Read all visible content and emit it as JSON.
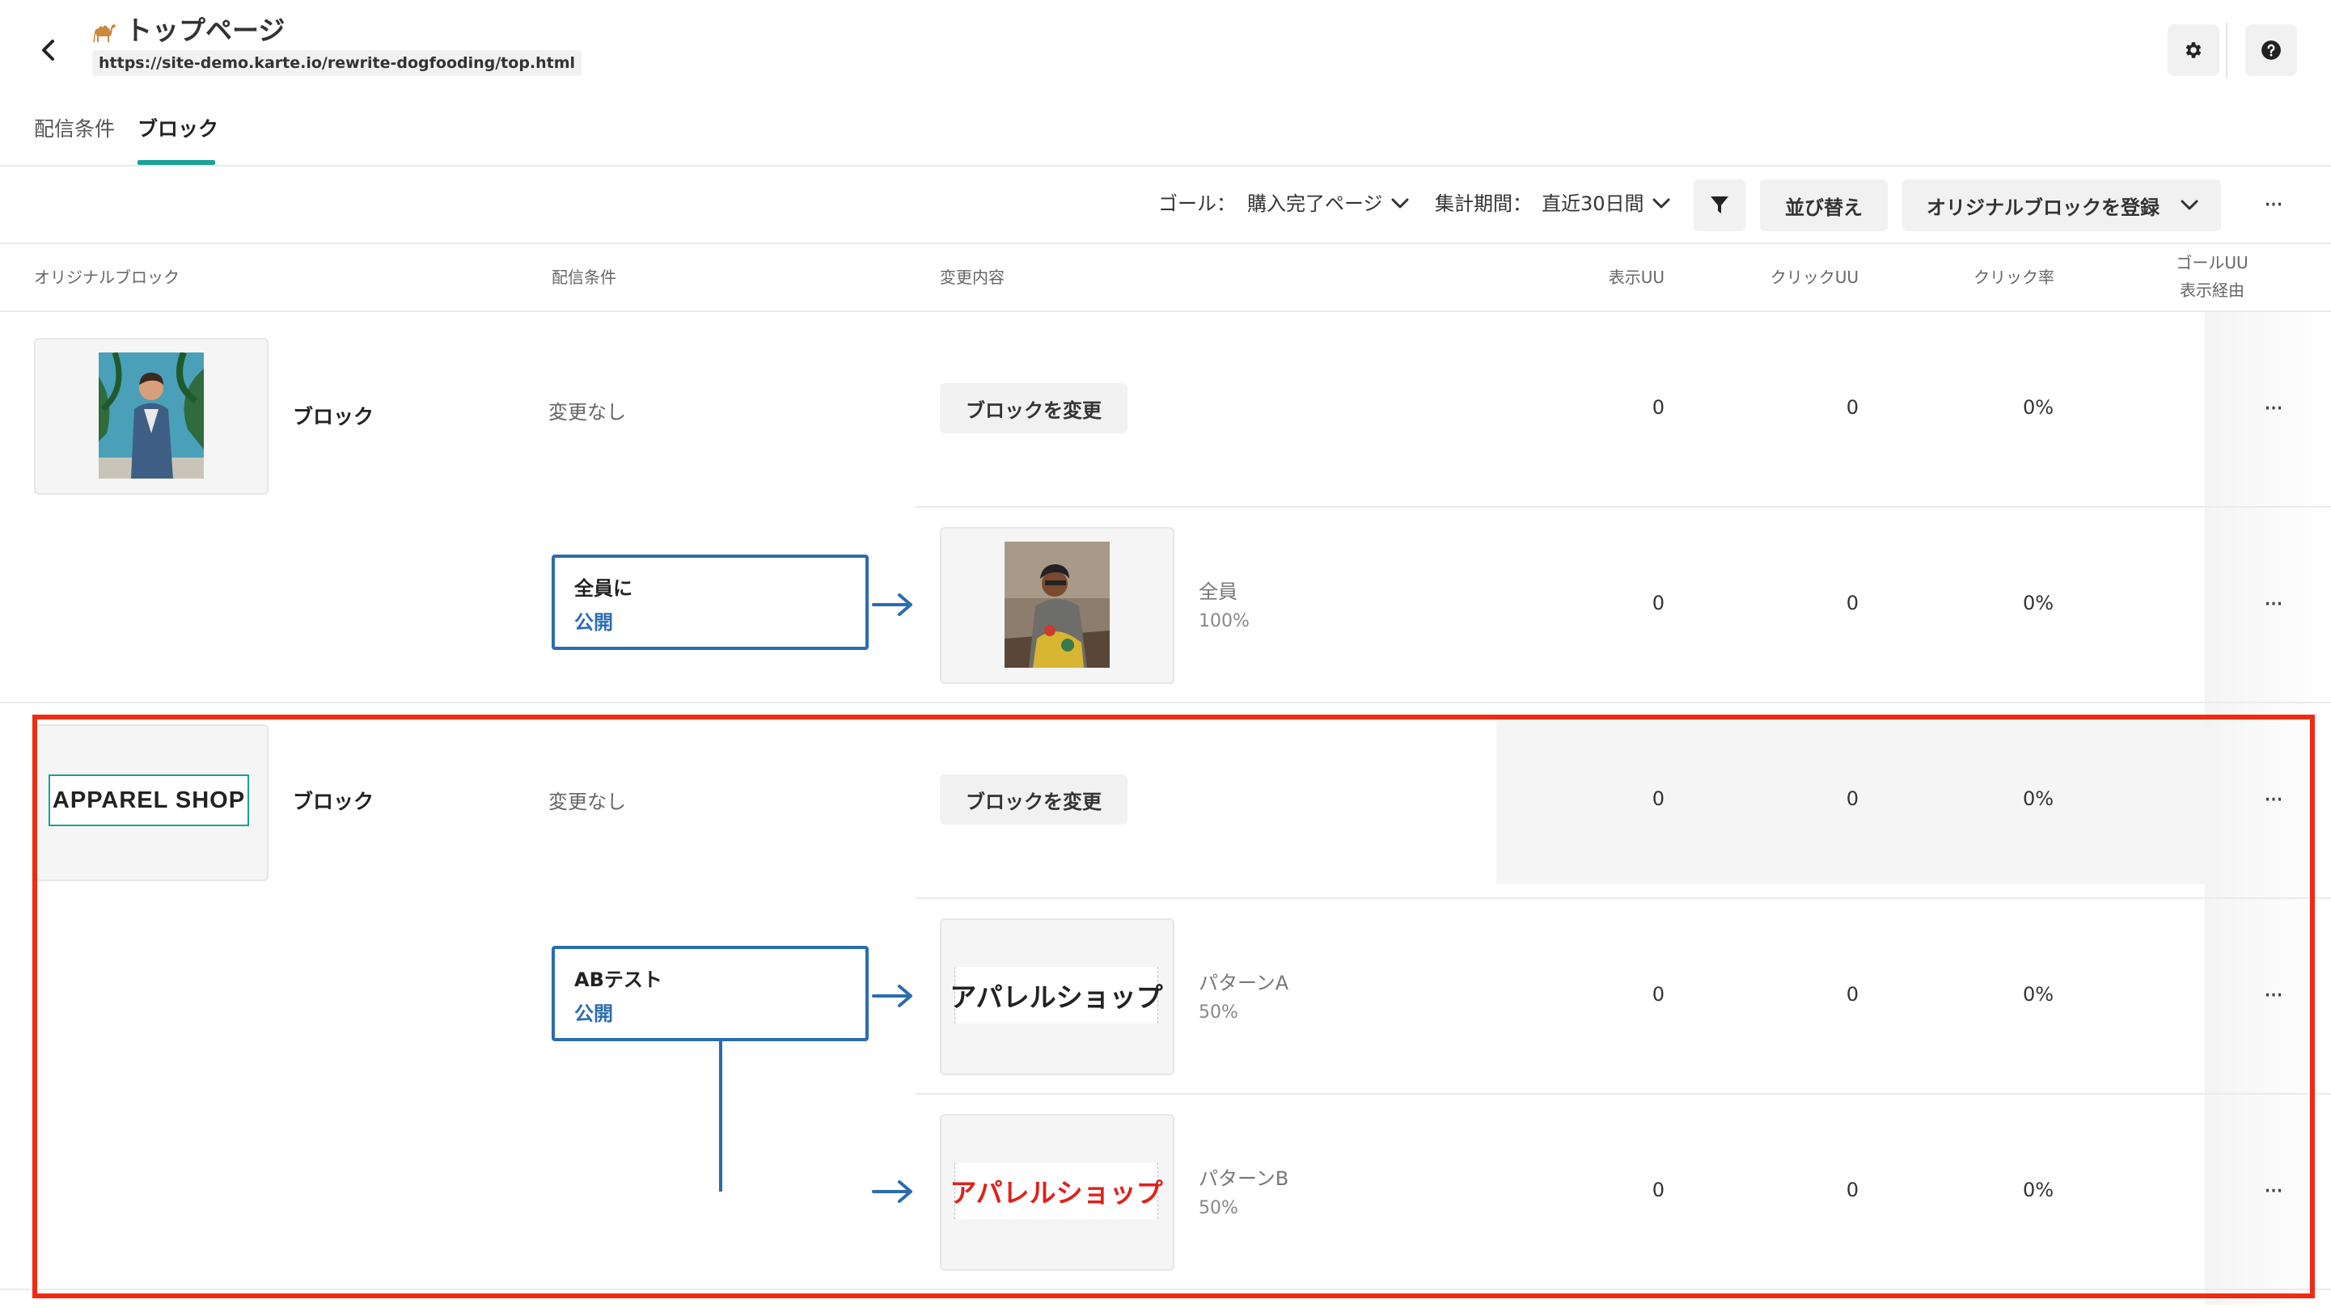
{
  "header": {
    "title": "トップページ",
    "url": "https://site-demo.karte.io/rewrite-dogfooding/top.html",
    "emoji_icon": "camel-icon",
    "back_icon": "chevron-left-icon",
    "settings_icon": "gear-icon",
    "help_icon": "question-circle-icon"
  },
  "tabs": [
    {
      "label": "配信条件",
      "active": false
    },
    {
      "label": "ブロック",
      "active": true
    }
  ],
  "toolbar": {
    "goal_label": "ゴール：",
    "goal_value": "購入完了ページ",
    "period_label": "集計期間：",
    "period_value": "直近30日間",
    "filter_icon": "filter-icon",
    "sort_button": "並び替え",
    "register_button": "オリジナルブロックを登録",
    "more_icon": "more-horizontal-icon"
  },
  "columns": {
    "original_block": "オリジナルブロック",
    "condition": "配信条件",
    "change": "変更内容",
    "display_uu": "表示UU",
    "click_uu": "クリックUU",
    "click_rate": "クリック率",
    "goal_uu_line1": "ゴールUU",
    "goal_uu_line2": "表示経由"
  },
  "blocks": [
    {
      "label": "ブロック",
      "no_change": "変更なし",
      "change_button": "ブロックを変更",
      "base_stats": {
        "display": "0",
        "click": "0",
        "rate": "0%"
      },
      "condition": {
        "title": "全員に",
        "status": "公開"
      },
      "variants": [
        {
          "name": "全員",
          "ratio": "100%",
          "display": "0",
          "click": "0",
          "rate": "0%"
        }
      ]
    },
    {
      "label": "ブロック",
      "logo_text": "APPAREL SHOP",
      "no_change": "変更なし",
      "change_button": "ブロックを変更",
      "base_stats": {
        "display": "0",
        "click": "0",
        "rate": "0%"
      },
      "condition": {
        "title": "ABテスト",
        "status": "公開"
      },
      "variants": [
        {
          "name": "パターンA",
          "ratio": "50%",
          "banner": "アパレルショップ",
          "display": "0",
          "click": "0",
          "rate": "0%"
        },
        {
          "name": "パターンB",
          "ratio": "50%",
          "banner": "アパレルショップ",
          "display": "0",
          "click": "0",
          "rate": "0%"
        }
      ]
    }
  ],
  "colors": {
    "accent_teal": "#1aa198",
    "condition_blue": "#2b6cb0",
    "highlight_red": "#ef2b12",
    "variant_b_red": "#e0201b"
  }
}
